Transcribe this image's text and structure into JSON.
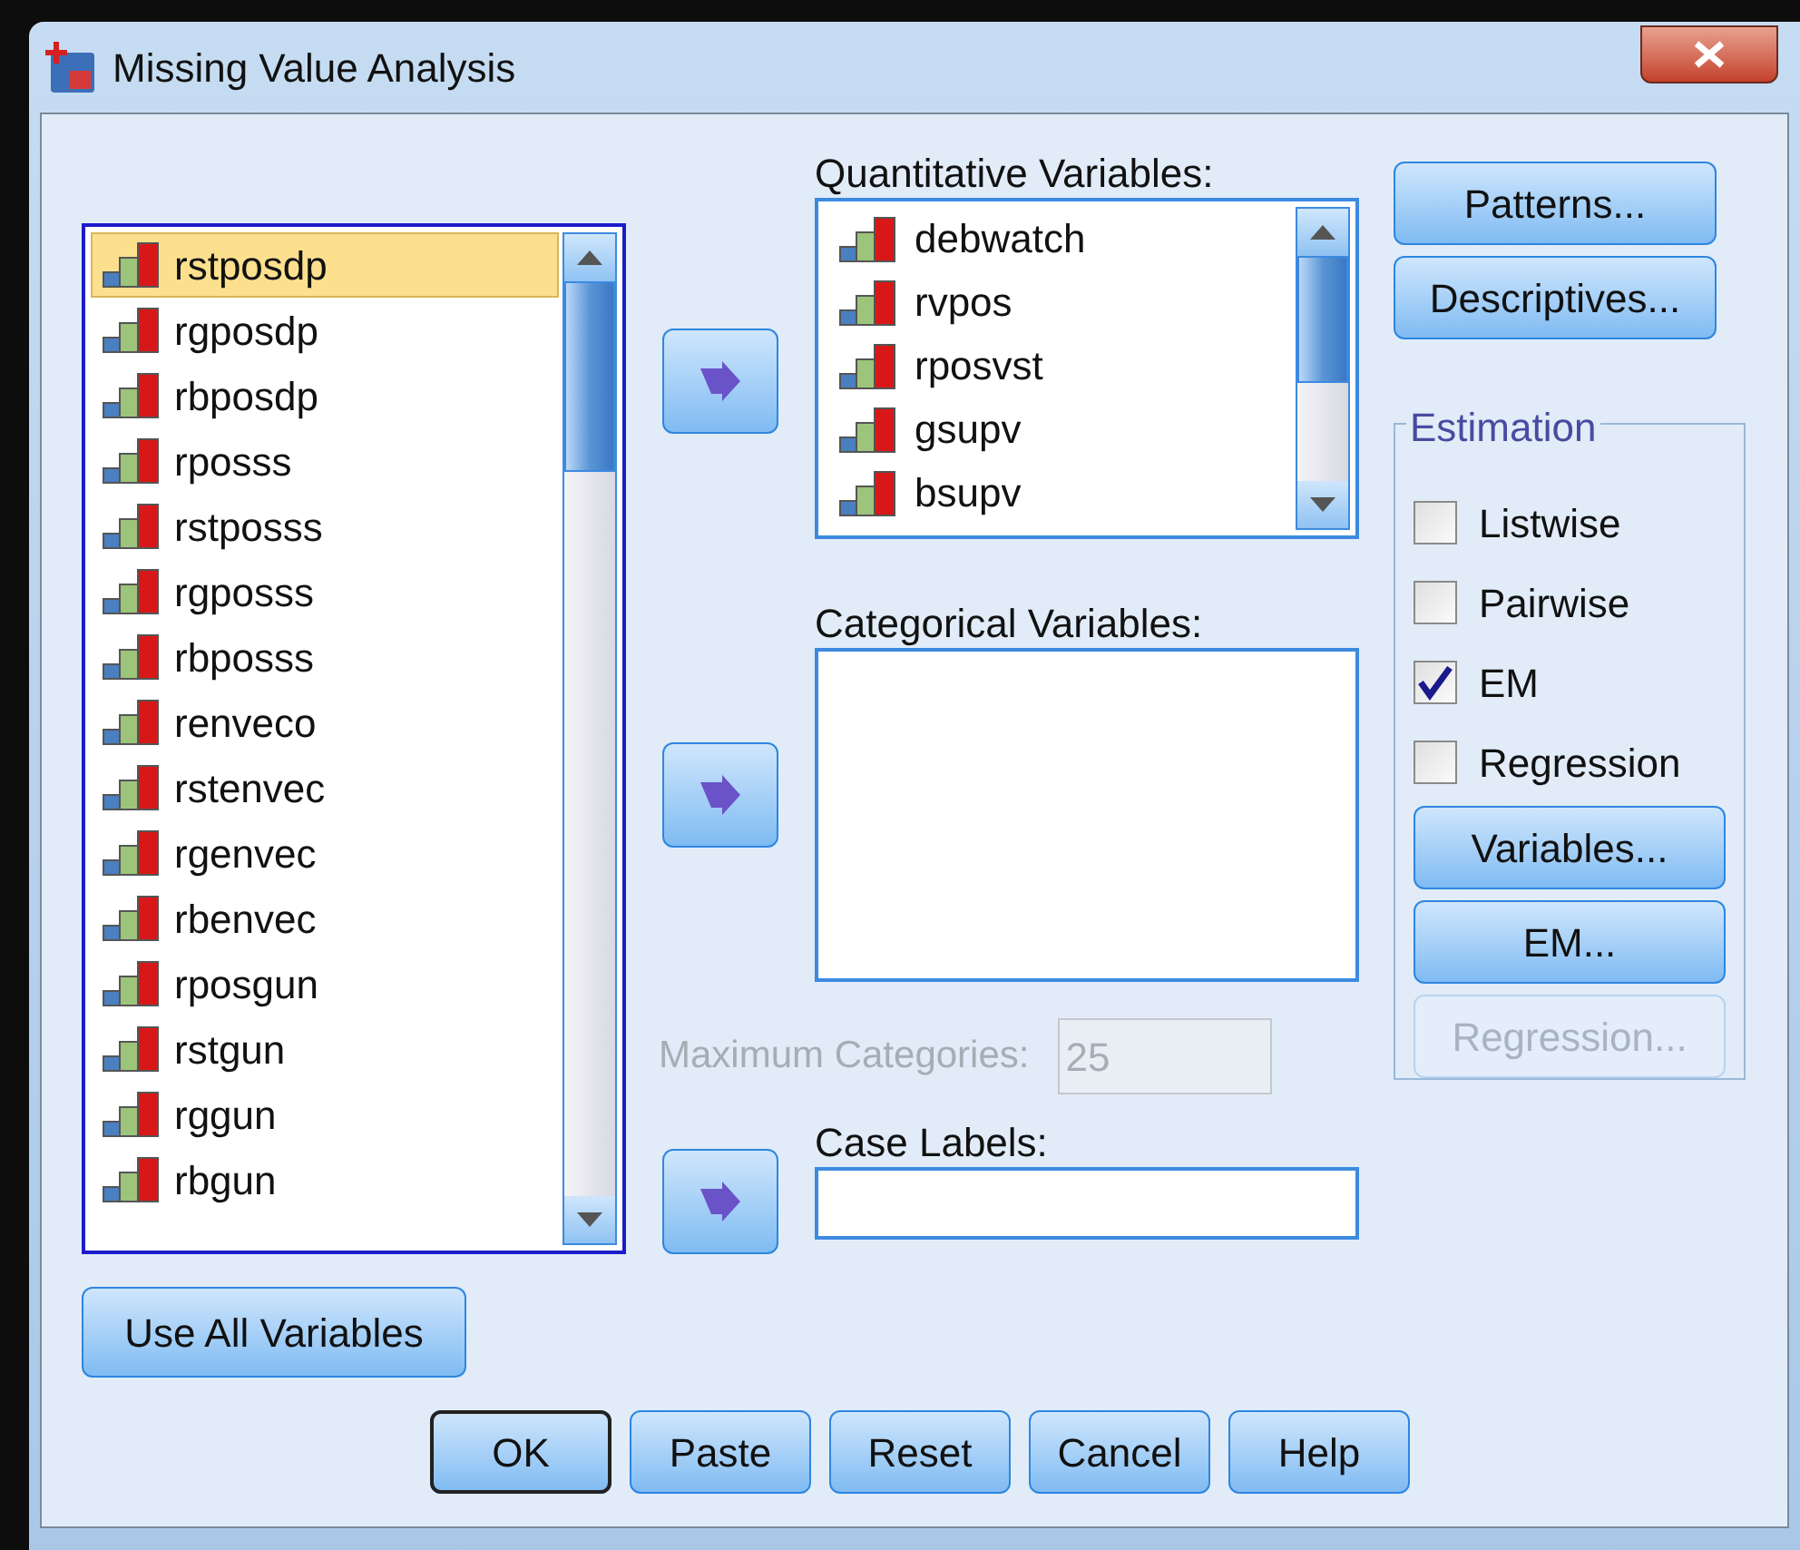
{
  "window": {
    "title": "Missing Value Analysis"
  },
  "source_list": {
    "items": [
      {
        "name": "rstposdp",
        "selected": true
      },
      {
        "name": "rgposdp",
        "selected": false
      },
      {
        "name": "rbposdp",
        "selected": false
      },
      {
        "name": "rposss",
        "selected": false
      },
      {
        "name": "rstposss",
        "selected": false
      },
      {
        "name": "rgposss",
        "selected": false
      },
      {
        "name": "rbposss",
        "selected": false
      },
      {
        "name": "renveco",
        "selected": false
      },
      {
        "name": "rstenvec",
        "selected": false
      },
      {
        "name": "rgenvec",
        "selected": false
      },
      {
        "name": "rbenvec",
        "selected": false
      },
      {
        "name": "rposgun",
        "selected": false
      },
      {
        "name": "rstgun",
        "selected": false
      },
      {
        "name": "rggun",
        "selected": false
      },
      {
        "name": "rbgun",
        "selected": false
      }
    ]
  },
  "quantitative": {
    "label": "Quantitative Variables:",
    "items": [
      {
        "name": "debwatch"
      },
      {
        "name": "rvpos"
      },
      {
        "name": "rposvst"
      },
      {
        "name": "gsupv"
      },
      {
        "name": "bsupv"
      }
    ]
  },
  "categorical": {
    "label": "Categorical Variables:"
  },
  "max_categories": {
    "label": "Maximum Categories:",
    "value": "25",
    "disabled": true
  },
  "case_labels": {
    "label": "Case Labels:"
  },
  "side_buttons": [
    {
      "label": "Patterns..."
    },
    {
      "label": "Descriptives..."
    }
  ],
  "estimation": {
    "title": "Estimation",
    "options": [
      {
        "label": "Listwise",
        "checked": false
      },
      {
        "label": "Pairwise",
        "checked": false
      },
      {
        "label": "EM",
        "checked": true
      },
      {
        "label": "Regression",
        "checked": false
      }
    ],
    "buttons": [
      {
        "label": "Variables...",
        "disabled": false
      },
      {
        "label": "EM...",
        "disabled": false
      },
      {
        "label": "Regression...",
        "disabled": true
      }
    ]
  },
  "use_all_button": {
    "label": "Use All Variables"
  },
  "footer_buttons": [
    {
      "label": "OK",
      "default": true
    },
    {
      "label": "Paste",
      "default": false
    },
    {
      "label": "Reset",
      "default": false
    },
    {
      "label": "Cancel",
      "default": false
    },
    {
      "label": "Help",
      "default": false
    }
  ]
}
